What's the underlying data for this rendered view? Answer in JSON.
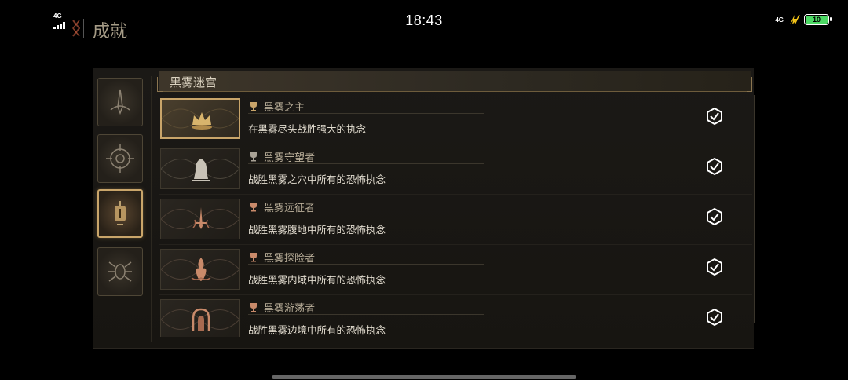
{
  "status_bar": {
    "time": "18:43",
    "left_network": "4G",
    "right_network": "4G",
    "battery": "10",
    "battery_color": "#4cd964"
  },
  "header": {
    "title": "成就",
    "back_icon": "back-logo-icon"
  },
  "sidebar": {
    "tabs": [
      {
        "icon": "blade-emblem-icon",
        "active": false
      },
      {
        "icon": "compass-emblem-icon",
        "active": false
      },
      {
        "icon": "lantern-emblem-icon",
        "active": true
      },
      {
        "icon": "spider-emblem-icon",
        "active": false
      }
    ]
  },
  "section": {
    "title": "黑雾迷宫"
  },
  "achievements": [
    {
      "title": "黑雾之主",
      "desc": "在黑雾尽头战胜强大的执念",
      "icon": "crown-emblem-icon",
      "highlighted": true
    },
    {
      "title": "黑雾守望者",
      "desc": "战胜黑雾之穴中所有的恐怖执念",
      "icon": "hooded-figure-icon",
      "highlighted": false
    },
    {
      "title": "黑雾远征者",
      "desc": "战胜黑雾腹地中所有的恐怖执念",
      "icon": "sword-emblem-icon",
      "highlighted": false
    },
    {
      "title": "黑雾探险者",
      "desc": "战胜黑雾内域中所有的恐怖执念",
      "icon": "flame-emblem-icon",
      "highlighted": false
    },
    {
      "title": "黑雾游荡者",
      "desc": "战胜黑雾边境中所有的恐怖执念",
      "icon": "arch-emblem-icon",
      "highlighted": false
    }
  ],
  "colors": {
    "accent_gold": "#c9a56a",
    "text_muted": "#b8ad98",
    "panel_bg": "#1b1916"
  }
}
